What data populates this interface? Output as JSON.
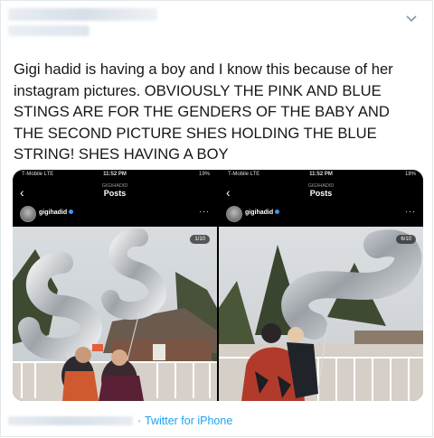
{
  "tweet": {
    "text": "Gigi hadid is having a boy and I know this because of her instagram pictures. OBVIOUSLY THE PINK AND BLUE STINGS ARE FOR THE GENDERS OF THE BABY AND THE SECOND PICTURE SHES HOLDING THE BLUE STRING! SHES HAVING A BOY",
    "separator": "·",
    "source": "Twitter for iPhone"
  },
  "media": {
    "left": {
      "carrier": "T-Mobile  LTE",
      "time": "11:52 PM",
      "battery": "19%",
      "profile_caption": "GIGIHADID",
      "header_title": "Posts",
      "username": "gigihadid",
      "counter": "1/10",
      "more": "···"
    },
    "right": {
      "carrier": "T-Mobile  LTE",
      "time": "11:52 PM",
      "battery": "18%",
      "profile_caption": "GIGIHADID",
      "header_title": "Posts",
      "username": "gigihadid",
      "counter": "6/10",
      "more": "···"
    }
  },
  "colors": {
    "text": "#14171a",
    "link": "#1da1f2",
    "muted": "#657786",
    "border": "#e1e8ed"
  },
  "icons": [
    "chevron-down-icon",
    "back-arrow-icon",
    "verified-badge-icon",
    "more-options-icon"
  ]
}
